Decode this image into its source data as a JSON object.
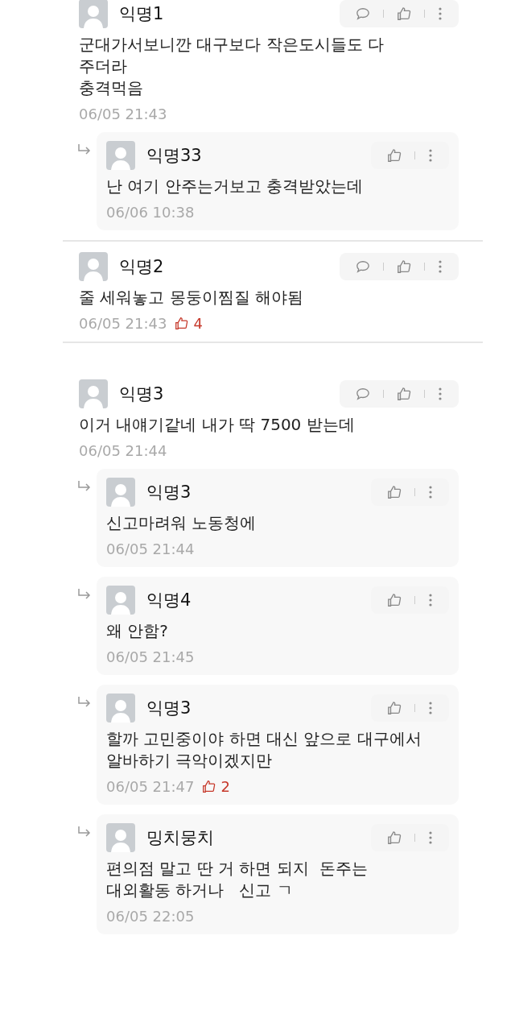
{
  "comments": [
    {
      "author": "익명1",
      "text": "군대가서보니깐 대구보다 작은도시들도 다\n주더라\n충격먹음",
      "time": "06/05 21:43",
      "replies": [
        {
          "author": "익명33",
          "text": "난 여기 안주는거보고 충격받았는데",
          "time": "06/06 10:38"
        }
      ]
    },
    {
      "author": "익명2",
      "text": "줄 세워놓고 몽둥이찜질 해야됨",
      "time": "06/05 21:43",
      "likes": "4"
    },
    {
      "author": "익명3",
      "text": "이거 내얘기같네 내가 딱 7500 받는데",
      "time": "06/05 21:44",
      "replies": [
        {
          "author": "익명3",
          "text": "신고마려워 노동청에",
          "time": "06/05 21:44"
        },
        {
          "author": "익명4",
          "text": "왜 안함?",
          "time": "06/05 21:45"
        },
        {
          "author": "익명3",
          "text": "할까 고민중이야 하면 대신 앞으로 대구에서\n알바하기 극악이겠지만",
          "time": "06/05 21:47",
          "likes": "2"
        },
        {
          "author": "밍치뭉치",
          "text": "편의점 말고 딴 거 하면 되지  돈주는\n대외활동 하거나   신고 ㄱ",
          "time": "06/05 22:05"
        }
      ]
    }
  ]
}
